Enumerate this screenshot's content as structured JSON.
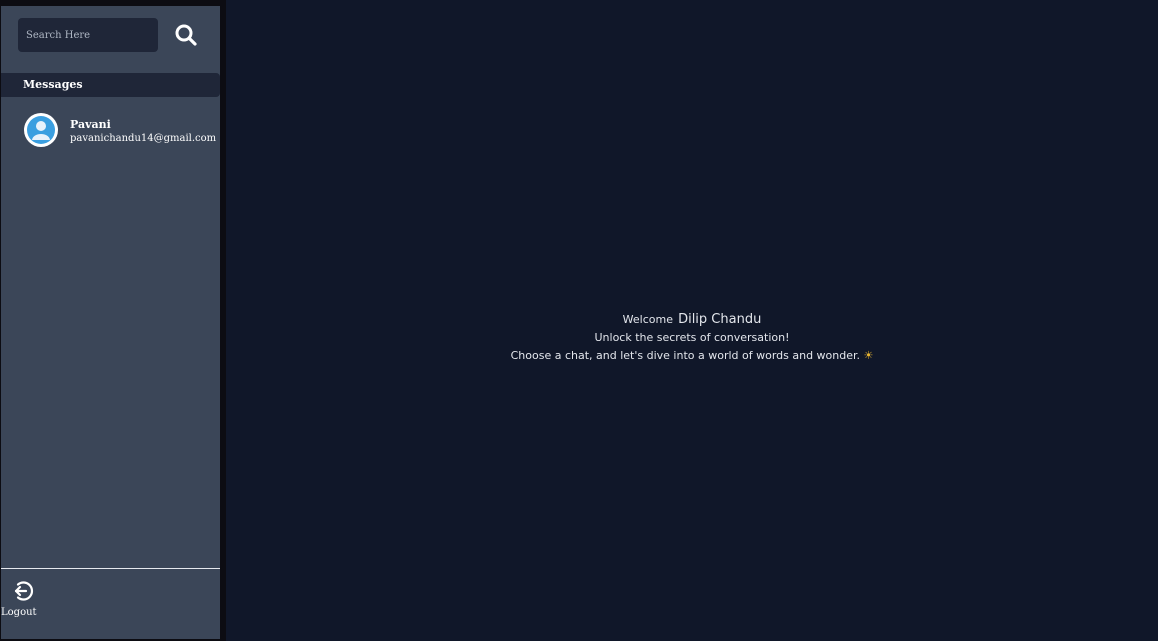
{
  "search": {
    "placeholder": "Search Here",
    "value": ""
  },
  "sidebar": {
    "section_title": "Messages",
    "contacts": [
      {
        "name": "Pavani",
        "email": "pavanichandu14@gmail.com",
        "avatar_icon": "user-avatar-icon"
      }
    ],
    "logout_label": "Logout"
  },
  "main": {
    "welcome_prefix": "Welcome",
    "user_name": "Dilip Chandu",
    "tagline": "Unlock the secrets of conversation!",
    "prompt": "Choose a chat, and let's dive into a world of words and wonder.",
    "emoji": "☀"
  },
  "icons": {
    "search": "search-icon",
    "logout": "logout-icon",
    "avatar": "user-avatar-icon",
    "sun": "sun-emoji-icon"
  },
  "colors": {
    "sidebar_bg": "#3b4658",
    "header_bg": "#1f2638",
    "main_bg": "#101729",
    "text": "#ffffff",
    "avatar_ring": "#ffffff",
    "avatar_fill": "#3b9fe0"
  }
}
